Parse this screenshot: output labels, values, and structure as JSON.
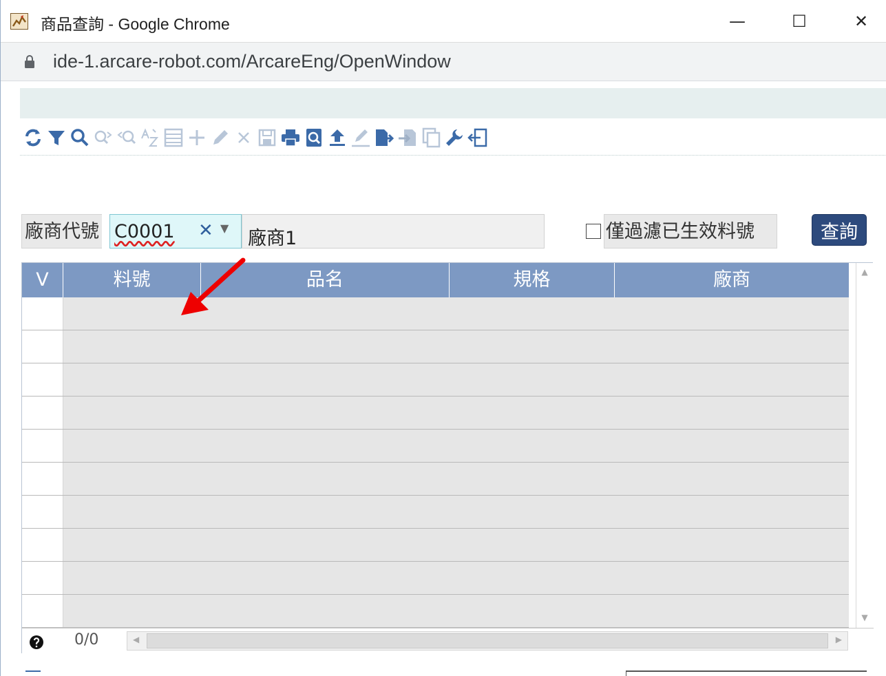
{
  "window": {
    "title": "商品查詢 - Google Chrome",
    "url": "ide-1.arcare-robot.com/ArcareEng/OpenWindow",
    "controls": {
      "minimize": "—",
      "maximize": "☐",
      "close": "✕"
    }
  },
  "toolbar": {
    "icons": [
      "refresh-icon",
      "filter-icon",
      "search-icon",
      "find-next-icon",
      "find-prev-icon",
      "sort-az-icon",
      "list-icon",
      "add-icon",
      "edit-icon",
      "delete-icon",
      "save-icon",
      "print-icon",
      "preview-icon",
      "upload-icon",
      "sign-icon",
      "export-icon",
      "import-icon",
      "copy-icon",
      "tools-icon",
      "exit-icon"
    ]
  },
  "filter": {
    "vendor_label": "廠商代號",
    "vendor_code": "C0001",
    "clear_symbol": "✕",
    "dropdown_symbol": "▼",
    "vendor_name": "廠商1",
    "checkbox_label": "僅過濾已生效料號",
    "checkbox_checked": false,
    "query_button": "查詢"
  },
  "grid": {
    "columns": [
      "V",
      "料號",
      "品名",
      "規格",
      "廠商"
    ],
    "rows": [
      [],
      [],
      [],
      [],
      [],
      [],
      [],
      [],
      [],
      []
    ],
    "pager": "0/0"
  },
  "colors": {
    "header_bg": "#7d99c3",
    "query_button_bg": "#2d4a7d",
    "input_bg": "#dff7f9",
    "annotation_arrow": "#ee0000"
  }
}
